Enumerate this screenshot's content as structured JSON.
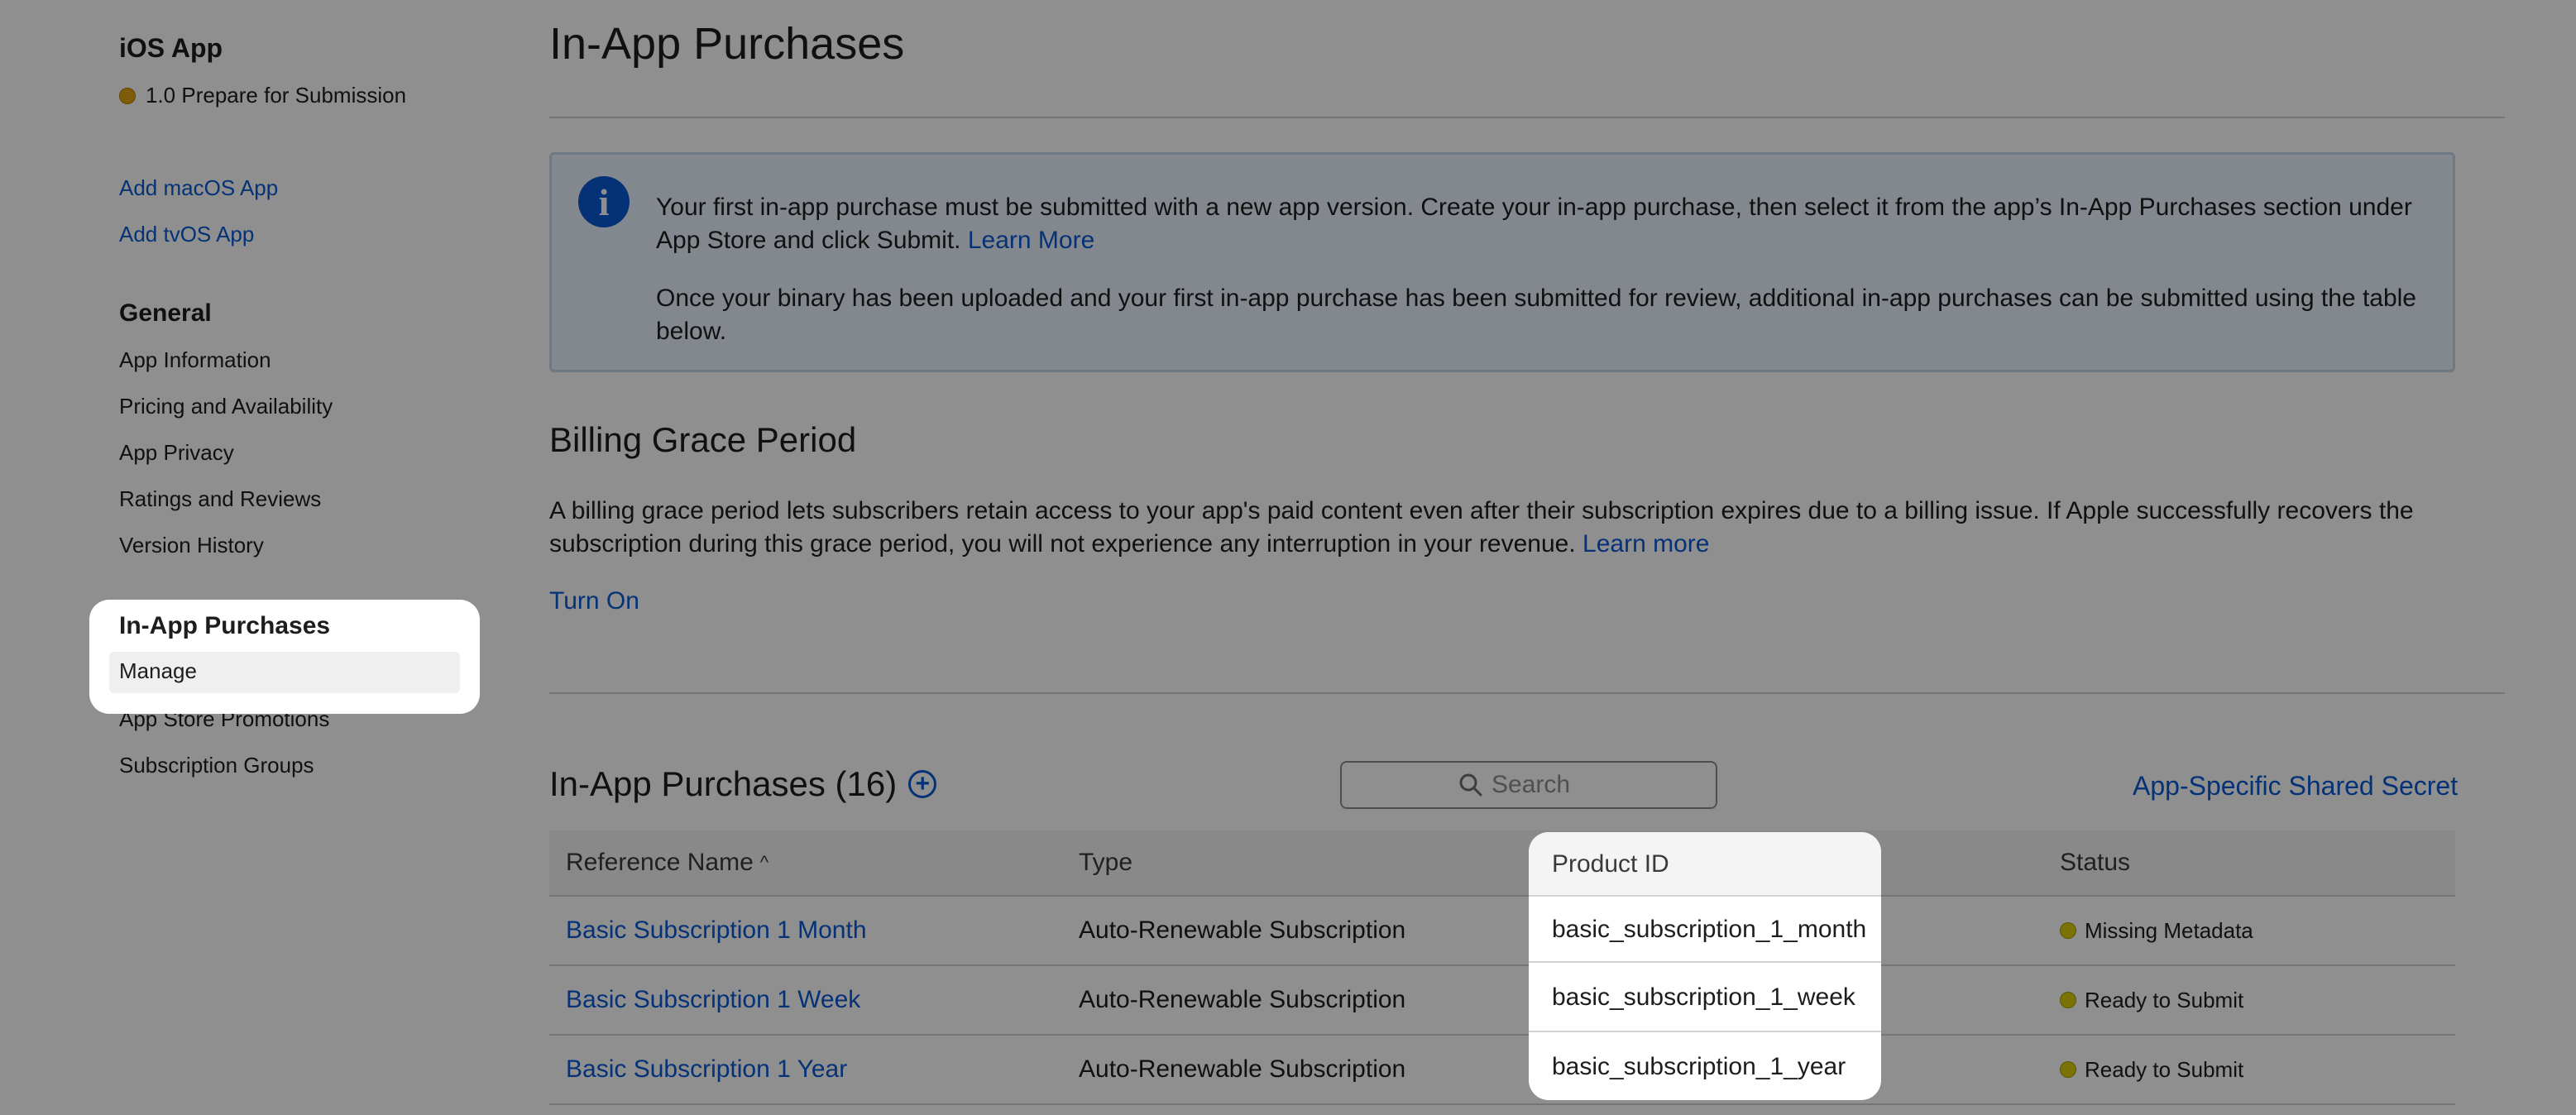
{
  "sidebar": {
    "app_title": "iOS App",
    "version_status": "1.0 Prepare for Submission",
    "add_links": [
      "Add macOS App",
      "Add tvOS App"
    ],
    "general_heading": "General",
    "general_items": [
      "App Information",
      "Pricing and Availability",
      "App Privacy",
      "Ratings and Reviews",
      "Version History"
    ],
    "iap_heading": "In-App Purchases",
    "iap_items": [
      "Manage",
      "App Store Promotions",
      "Subscription Groups"
    ]
  },
  "main": {
    "title": "In-App Purchases",
    "info": {
      "icon": "info-icon",
      "p1": "Your first in-app purchase must be submitted with a new app version. Create your in-app purchase, then select it from the app’s In-App Purchases section under App Store and click Submit.",
      "p1_link": "Learn More",
      "p2": "Once your binary has been uploaded and your first in-app purchase has been submitted for review, additional in-app purchases can be submitted using the table below."
    },
    "billing": {
      "heading": "Billing Grace Period",
      "text": "A billing grace period lets subscribers retain access to your app's paid content even after their subscription expires due to a billing issue. If Apple successfully recovers the subscription during this grace period, you will not experience any interruption in your revenue.",
      "link": "Learn more",
      "action": "Turn On"
    },
    "iap_list": {
      "heading": "In-App Purchases (16)",
      "search_placeholder": "Search",
      "shared_secret_link": "App-Specific Shared Secret",
      "columns": [
        "Reference Name",
        "Type",
        "Product ID",
        "Status"
      ],
      "sort_indicator": "^",
      "rows": [
        {
          "name": "Basic Subscription 1 Month",
          "type": "Auto-Renewable Subscription",
          "product_id": "basic_subscription_1_month",
          "status": "Missing Metadata"
        },
        {
          "name": "Basic Subscription 1 Week",
          "type": "Auto-Renewable Subscription",
          "product_id": "basic_subscription_1_week",
          "status": "Ready to Submit"
        },
        {
          "name": "Basic Subscription 1 Year",
          "type": "Auto-Renewable Subscription",
          "product_id": "basic_subscription_1_year",
          "status": "Ready to Submit"
        }
      ]
    }
  },
  "colors": {
    "link": "#0a5ad4",
    "status_orange": "#e3a50d",
    "status_yellow": "#d9cc09",
    "info_bg": "#e8f2fc",
    "overlay": "rgba(0,0,0,0.44)"
  }
}
